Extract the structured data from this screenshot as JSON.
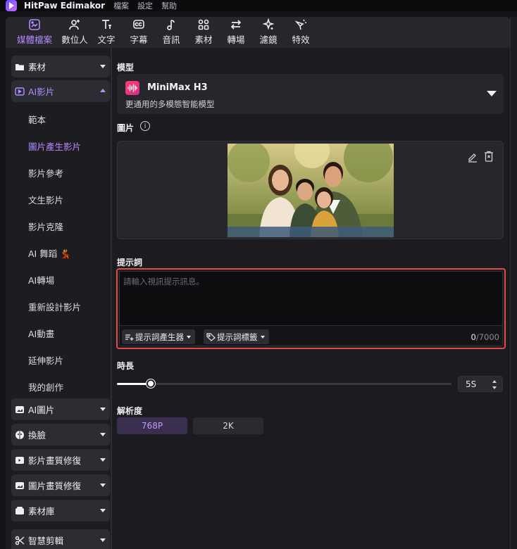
{
  "app": {
    "name": "HitPaw Edimakor",
    "menu": [
      "檔案",
      "設定",
      "幫助"
    ]
  },
  "toolbar": {
    "items": [
      {
        "label": "媒體檔案",
        "icon": "media-icon",
        "active": true
      },
      {
        "label": "數位人",
        "icon": "avatar-icon",
        "active": false
      },
      {
        "label": "文字",
        "icon": "text-icon",
        "active": false
      },
      {
        "label": "字幕",
        "icon": "subtitle-icon",
        "active": false
      },
      {
        "label": "音訊",
        "icon": "music-icon",
        "active": false
      },
      {
        "label": "素材",
        "icon": "assets-icon",
        "active": false
      },
      {
        "label": "轉場",
        "icon": "transition-icon",
        "active": false
      },
      {
        "label": "濾鏡",
        "icon": "filter-icon",
        "active": false
      },
      {
        "label": "特效",
        "icon": "effects-icon",
        "active": false
      }
    ]
  },
  "sidebar": {
    "categories": [
      {
        "label": "素材",
        "icon": "folder-icon",
        "open": false
      },
      {
        "label": "AI影片",
        "icon": "ai-video-icon",
        "open": true
      },
      {
        "label": "AI圖片",
        "icon": "ai-image-icon",
        "open": false
      },
      {
        "label": "換臉",
        "icon": "face-swap-icon",
        "open": false
      },
      {
        "label": "影片畫質修復",
        "icon": "video-enhance-icon",
        "open": false
      },
      {
        "label": "圖片畫質修復",
        "icon": "image-enhance-icon",
        "open": false
      },
      {
        "label": "素材庫",
        "icon": "library-icon",
        "open": false
      },
      {
        "label": "智慧剪輯",
        "icon": "smart-cut-icon",
        "open": false
      }
    ],
    "ai_video_items": [
      {
        "label": "範本",
        "active": false
      },
      {
        "label": "圖片產生影片",
        "active": true
      },
      {
        "label": "影片參考",
        "active": false
      },
      {
        "label": "文生影片",
        "active": false
      },
      {
        "label": "影片克隆",
        "active": false
      },
      {
        "label": "AI 舞蹈 💃",
        "active": false
      },
      {
        "label": "AI轉場",
        "active": false
      },
      {
        "label": "重新設計影片",
        "active": false
      },
      {
        "label": "AI動畫",
        "active": false
      },
      {
        "label": "延伸影片",
        "active": false
      },
      {
        "label": "我的創作",
        "active": false
      }
    ]
  },
  "main": {
    "model": {
      "section_label": "模型",
      "name": "MiniMax H3",
      "description": "更通用的多模態智能模型"
    },
    "image": {
      "section_label": "圖片",
      "info_glyph": "i"
    },
    "prompt": {
      "section_label": "提示詞",
      "placeholder": "請輸入視訊提示訊息。",
      "generator_label": "提示詞產生器",
      "tags_label": "提示詞標籤",
      "count_current": "0",
      "count_max": "/7000"
    },
    "duration": {
      "section_label": "時長",
      "value": "5S",
      "slider_fraction": 0.1
    },
    "resolution": {
      "section_label": "解析度",
      "options": [
        "768P",
        "2K"
      ],
      "selected": "768P"
    }
  },
  "colors": {
    "accent": "#b48cff",
    "highlight_border": "#e04b48",
    "background": "#1b1b20"
  }
}
